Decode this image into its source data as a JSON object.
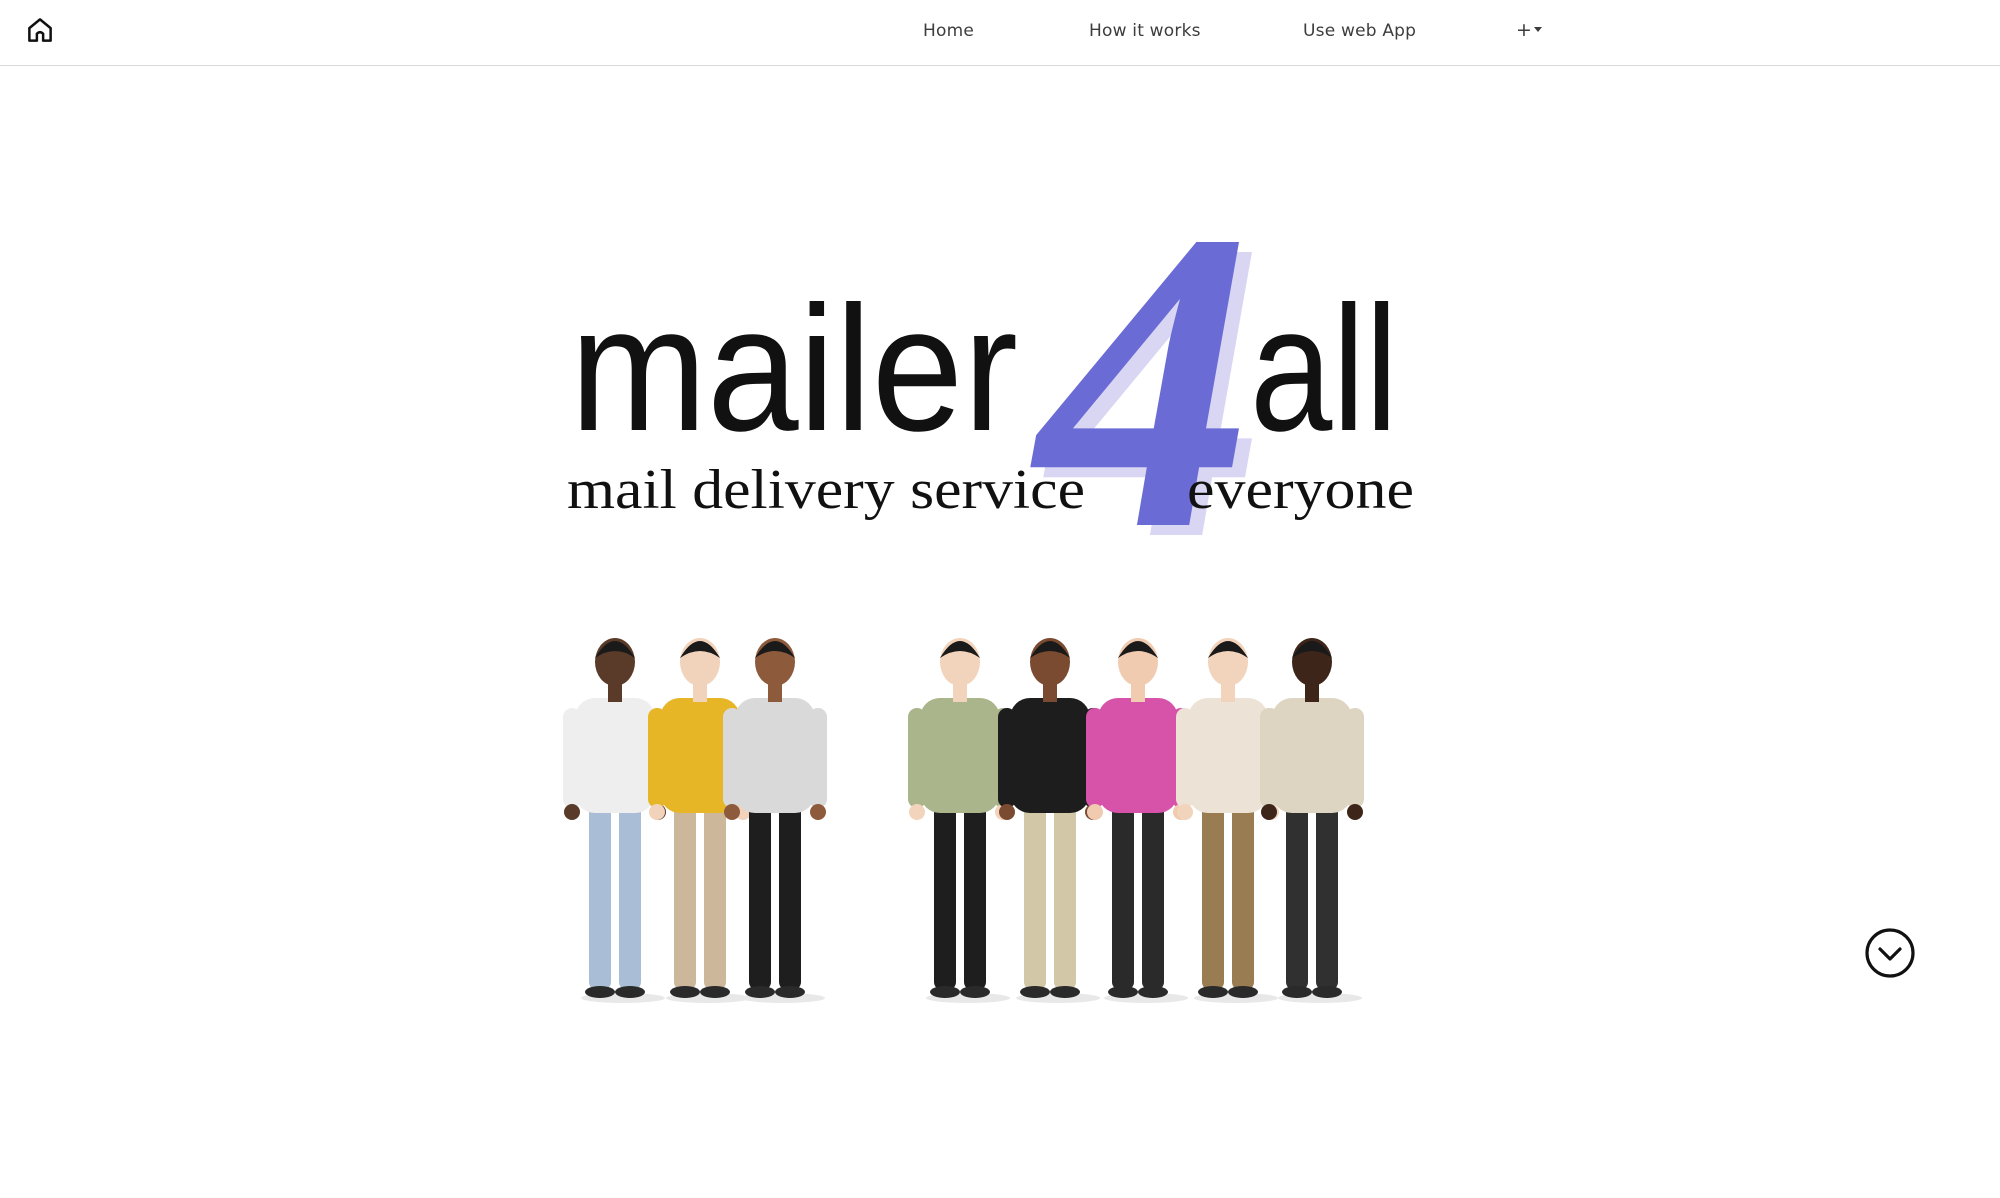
{
  "nav": {
    "home": "Home",
    "how_it_works": "How it works",
    "web_app": "Use web App",
    "more": "+"
  },
  "logo": {
    "word_left": "mailer",
    "numeral": "4",
    "word_right": "all",
    "tagline_left": "mail delivery service",
    "tagline_right": "everyone"
  },
  "icons": {
    "home": "home-icon",
    "scroll": "chevron-down-circle-icon",
    "caret": "caret-down-icon"
  },
  "colors": {
    "accent": "#6b6bd6",
    "accent_shadow": "#d8d6f2",
    "text": "#111111",
    "nav_text": "#3d3d3d"
  },
  "people": [
    {
      "shirt": "#eeeeee",
      "pants": "#a9bed6",
      "skin": "#5a3a28"
    },
    {
      "shirt": "#e6b626",
      "pants": "#cdb79a",
      "skin": "#f1d2bb"
    },
    {
      "shirt": "#d9d9d9",
      "pants": "#1e1e1e",
      "skin": "#8d5a3c"
    },
    {
      "shirt": "#aab58c",
      "pants": "#1e1e1e",
      "skin": "#f2d3bb"
    },
    {
      "shirt": "#1d1d1d",
      "pants": "#d2c7a6",
      "skin": "#7a4b30"
    },
    {
      "shirt": "#d653a9",
      "pants": "#2a2a2a",
      "skin": "#f0cbb0"
    },
    {
      "shirt": "#ece3d6",
      "pants": "#9a7c52",
      "skin": "#f2d3bb"
    },
    {
      "shirt": "#ddd4c2",
      "pants": "#303030",
      "skin": "#3d2619"
    }
  ]
}
